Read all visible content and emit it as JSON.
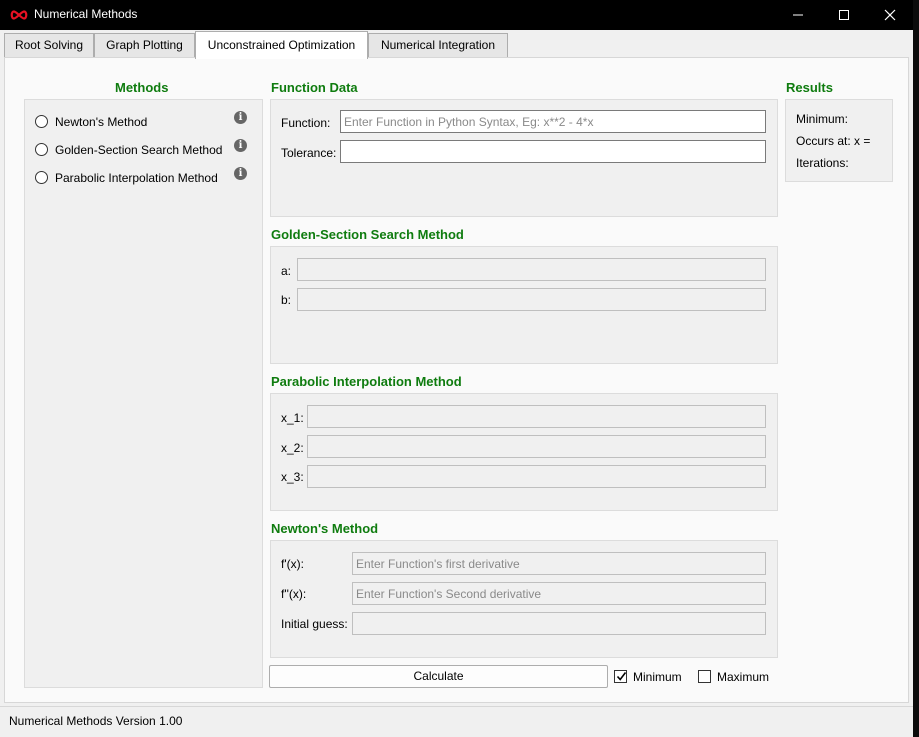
{
  "app": {
    "title": "Numerical Methods",
    "logo_icon": "infinity-icon",
    "logo_color": "#e81123"
  },
  "window_controls": {
    "minimize_icon": "minimize-icon",
    "maximize_icon": "maximize-icon",
    "close_icon": "close-icon"
  },
  "tabs": [
    {
      "label": "Root Solving"
    },
    {
      "label": "Graph Plotting"
    },
    {
      "label": "Unconstrained Optimization",
      "active": true
    },
    {
      "label": "Numerical Integration"
    }
  ],
  "methods": {
    "title": "Methods",
    "items": [
      {
        "label": "Newton's Method",
        "selected": false
      },
      {
        "label": "Golden-Section Search Method",
        "selected": false
      },
      {
        "label": "Parabolic Interpolation Method",
        "selected": false
      }
    ],
    "info_glyph": "i"
  },
  "function_data": {
    "title": "Function Data",
    "function_label": "Function:",
    "function_value": "",
    "function_placeholder": "Enter Function in Python Syntax, Eg: x**2 - 4*x",
    "tolerance_label": "Tolerance:",
    "tolerance_value": ""
  },
  "golden_section": {
    "title": "Golden-Section Search Method",
    "a_label": "a:",
    "b_label": "b:"
  },
  "parabolic": {
    "title": "Parabolic Interpolation Method",
    "x1_label": "x_1:",
    "x2_label": "x_2:",
    "x3_label": "x_3:"
  },
  "newton": {
    "title": "Newton's Method",
    "fprime_label": "f'(x):",
    "fprime_placeholder": "Enter Function's first derivative",
    "fdoubleprime_label": "f''(x):",
    "fdoubleprime_placeholder": "Enter Function's Second derivative",
    "initial_guess_label": "Initial guess:"
  },
  "actions": {
    "calculate_label": "Calculate",
    "minimum_label": "Minimum",
    "minimum_checked": true,
    "maximum_label": "Maximum",
    "maximum_checked": false
  },
  "results": {
    "title": "Results",
    "minimum_label": "Minimum:",
    "occurs_label": "Occurs at: x =",
    "iterations_label": "Iterations:"
  },
  "status": {
    "text": "Numerical Methods Version 1.00"
  },
  "colors": {
    "section_title": "#0f7c0f",
    "titlebar": "#000000"
  }
}
